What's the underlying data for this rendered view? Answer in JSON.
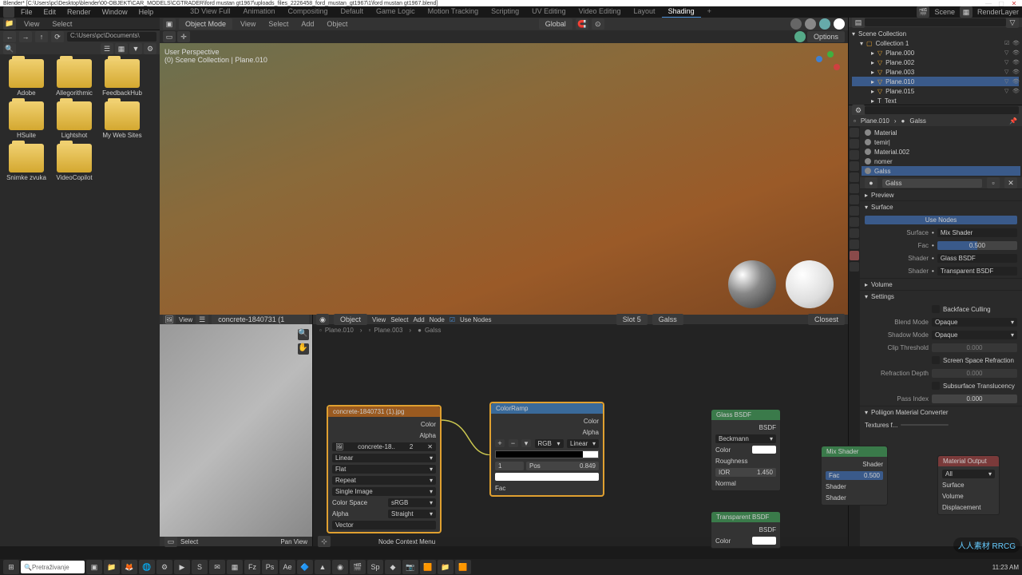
{
  "titlebar": {
    "text": "Blender* [C:\\Users\\pc\\Desktop\\blender\\00-OBJEKT\\CAR_MODELS\\CGTRADER\\ford mustan gt1967\\uploads_files_2226458_ford_mustan_gt1967\\1\\ford mustan gt1967.blend]",
    "min": "—",
    "max": "▢",
    "close": "✕"
  },
  "menubar": {
    "items": [
      "File",
      "Edit",
      "Render",
      "Window",
      "Help"
    ],
    "tabs": [
      "3D View Full",
      "Animation",
      "Compositing",
      "Default",
      "Game Logic",
      "Motion Tracking",
      "Scripting",
      "UV Editing",
      "Video Editing",
      "Layout",
      "Shading"
    ],
    "active_tab": "Shading",
    "add": "+",
    "scene": "Scene",
    "layer": "RenderLayer"
  },
  "fb": {
    "path": "C:\\Users\\pc\\Documents\\",
    "view": "View",
    "select": "Select",
    "folders": [
      "Adobe",
      "Allegorithmic",
      "FeedbackHub",
      "HSuite",
      "Lightshot",
      "My Web Sites",
      "Snimke zvuka",
      "VideoCopilot"
    ]
  },
  "vp_hdr": {
    "mode": "Object Mode",
    "items": [
      "View",
      "Select",
      "Add",
      "Object"
    ],
    "orient": "Global"
  },
  "vp": {
    "line1": "User Perspective",
    "line2": "(0) Scene Collection | Plane.010",
    "options": "Options"
  },
  "img": {
    "hdr_items": [
      "View"
    ],
    "name": "concrete-1840731 (1",
    "select": "Select",
    "footer": "Pan View",
    "status": "Node Context Menu"
  },
  "ne_hdr": {
    "items": [
      "Object",
      "View",
      "Select",
      "Add",
      "Node"
    ],
    "use_nodes": "Use Nodes",
    "slot": "Slot 5",
    "mat": "Galss",
    "closest": "Closest"
  },
  "bc": {
    "items": [
      "Plane.010",
      "Plane.003",
      "Galss"
    ]
  },
  "nodes": {
    "imgtex": {
      "title": "concrete-1840731 (1).jpg",
      "color": "Color",
      "alpha": "Alpha",
      "file": "concrete-18..",
      "num": "2",
      "interp": "Linear",
      "proj": "Flat",
      "ext": "Repeat",
      "single": "Single Image",
      "cspace_l": "Color Space",
      "cspace_v": "sRGB",
      "alpha_l": "Alpha",
      "alpha_v": "Straight",
      "vector": "Vector"
    },
    "colorramp": {
      "title": "ColorRamp",
      "color": "Color",
      "alpha": "Alpha",
      "mode": "RGB",
      "interp": "Linear",
      "handle": "1",
      "pos_l": "Pos",
      "pos_v": "0.849",
      "fac": "Fac"
    },
    "glass": {
      "title": "Glass BSDF",
      "bsdf": "BSDF",
      "dist": "Beckmann",
      "color": "Color",
      "rough": "Roughness",
      "ior_l": "IOR",
      "ior_v": "1.450",
      "normal": "Normal"
    },
    "trans": {
      "title": "Transparent BSDF",
      "bsdf": "BSDF",
      "color": "Color"
    },
    "mix": {
      "title": "Mix Shader",
      "shader": "Shader",
      "fac_l": "Fac",
      "fac_v": "0.500",
      "s1": "Shader",
      "s2": "Shader"
    },
    "out": {
      "title": "Material Output",
      "target": "All",
      "surf": "Surface",
      "vol": "Volume",
      "disp": "Displacement"
    }
  },
  "outliner": {
    "root": "Scene Collection",
    "coll": "Collection 1",
    "items": [
      "Plane.000",
      "Plane.002",
      "Plane.003",
      "Plane.010",
      "Plane.015",
      "Text"
    ],
    "selected": "Plane.010"
  },
  "props": {
    "bc": [
      "Plane.010",
      "Galss"
    ],
    "mats": [
      "Material",
      "temir|",
      "Material.002",
      "nomer",
      "Galss"
    ],
    "mat_sel": "Galss",
    "preview": "Preview",
    "surface": "Surface",
    "use_nodes": "Use Nodes",
    "surf": {
      "label": "Surface",
      "type": "Mix Shader",
      "fac_l": "Fac",
      "fac_v": "0.500",
      "s1_l": "Shader",
      "s1_v": "Glass BSDF",
      "s2_l": "Shader",
      "s2_v": "Transparent BSDF"
    },
    "volume": "Volume",
    "settings": {
      "title": "Settings",
      "backface": "Backface Culling",
      "blend_l": "Blend Mode",
      "blend_v": "Opaque",
      "shadow_l": "Shadow Mode",
      "shadow_v": "Opaque",
      "clip_l": "Clip Threshold",
      "clip_v": "0.000",
      "ssr": "Screen Space Refraction",
      "refdepth_l": "Refraction Depth",
      "refdepth_v": "0.000",
      "sst": "Subsurface Translucency",
      "pass_l": "Pass Index",
      "pass_v": "0.000"
    },
    "poligon": "Poliigon Material Converter",
    "textures": "Textures f..."
  },
  "taskbar": {
    "search": "Pretraživanje",
    "time": "11:23 AM"
  },
  "watermark": "人人素材 RRCG"
}
